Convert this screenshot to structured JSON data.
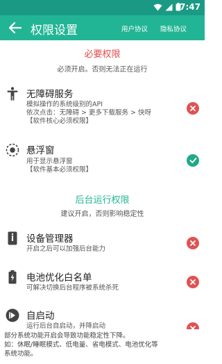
{
  "status_bar": {
    "time": "7:47"
  },
  "app_bar": {
    "title": "权限设置",
    "user_agreement": "用户协议",
    "privacy_agreement": "隐私协议"
  },
  "required": {
    "title": "必要权限",
    "subtitle": "必须开启。否则无法正在运行"
  },
  "background": {
    "title": "后台运行权限",
    "subtitle": "建议开启，否则影响稳定性"
  },
  "permissions": [
    {
      "title": "无障碍服务",
      "desc": [
        "模拟操作的系统级别的API",
        "依次点击：无障碍 > 更多下载服务 > 快呀",
        "【软件核心必须权限】"
      ],
      "status": "off",
      "icon": "accessibility-icon"
    },
    {
      "title": "悬浮窗",
      "desc": [
        "用于显示悬浮窗",
        "【软件基本必须权限】"
      ],
      "status": "on",
      "icon": "floating-window-icon"
    },
    {
      "title": "设备管理器",
      "desc": [
        "开启之后可以加强后台能力"
      ],
      "status": "off",
      "icon": "device-manager-icon"
    },
    {
      "title": "电池优化白名单",
      "desc": [
        "可解决切换后台程序被系统杀死"
      ],
      "status": "off",
      "icon": "battery-icon"
    },
    {
      "title": "自启动",
      "desc": [
        "运行后台自启动，并降启动"
      ],
      "status": "off",
      "icon": "autostart-icon"
    }
  ],
  "footer": {
    "line1": "部分系统功能开启会导致功能稳定性下降。",
    "line2": "如：休眠/睡眠模式、低电量、省电模式、电池优化等",
    "line3": "系统功能。"
  },
  "colors": {
    "primary": "#22b595",
    "status_bar": "#1a9a84",
    "danger": "#e05252",
    "success": "#21a98a",
    "required_title": "#e24b4b"
  }
}
